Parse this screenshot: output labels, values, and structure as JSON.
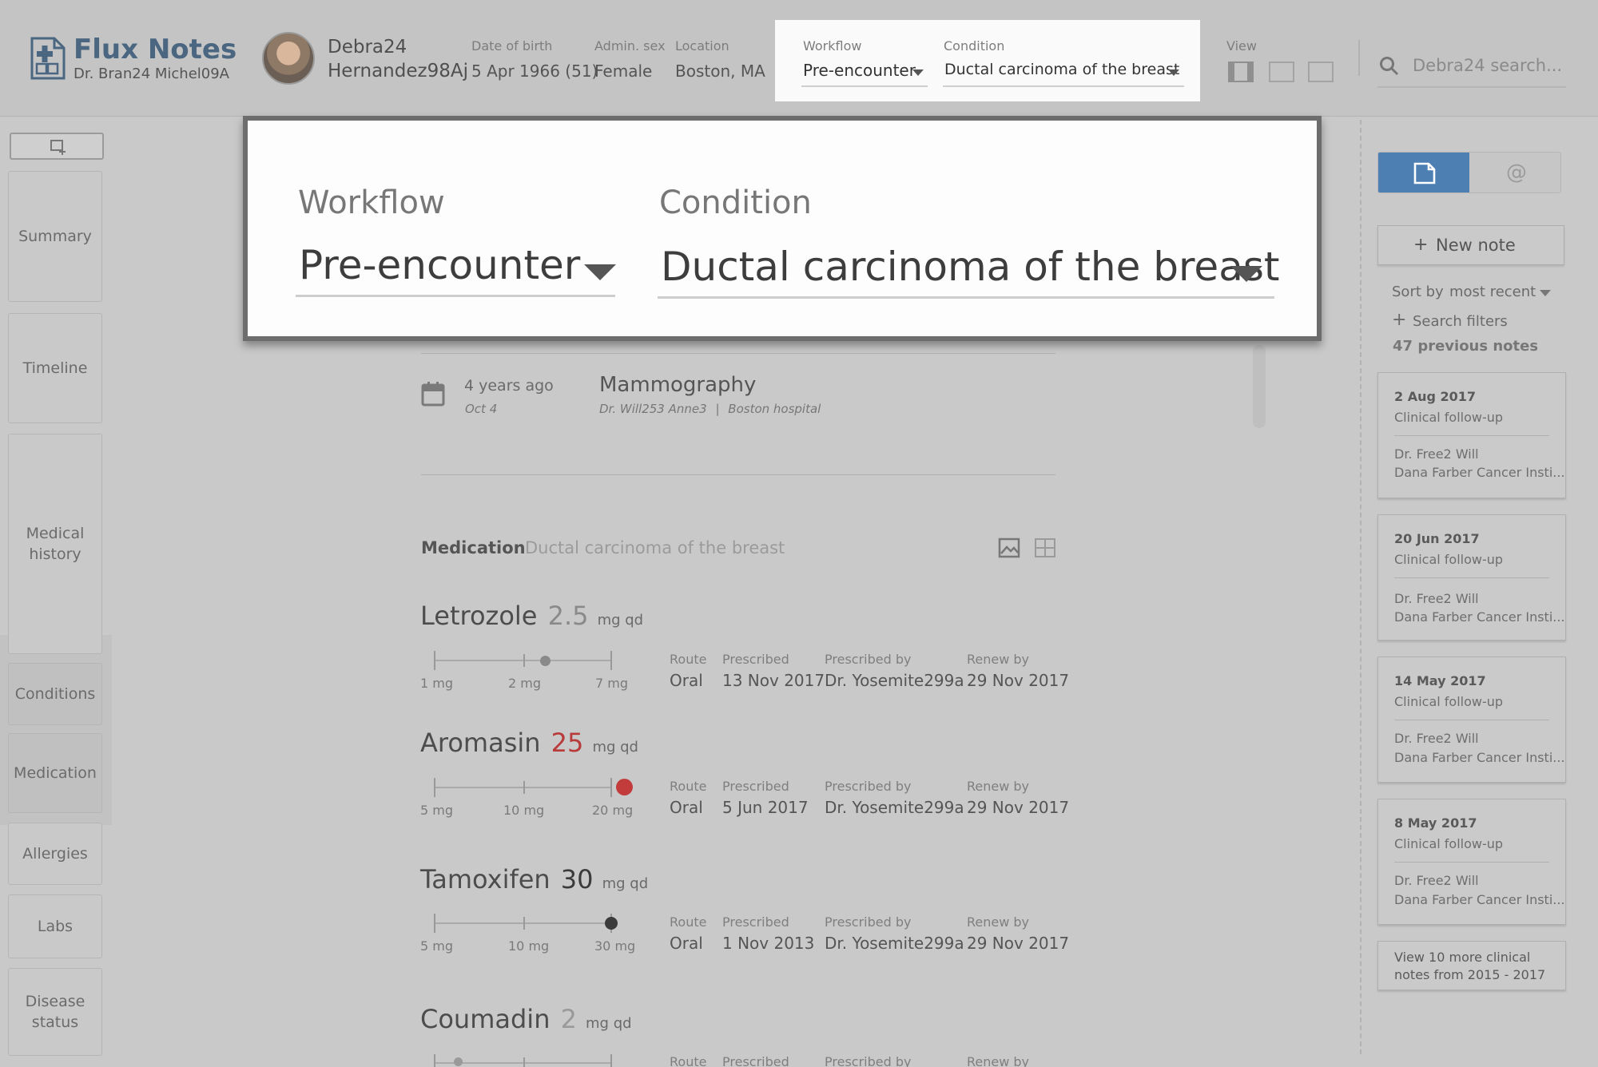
{
  "header": {
    "app_title": "Flux Notes",
    "doctor": "Dr. Bran24 Michel09A",
    "patient_first": "Debra24",
    "patient_last": "Hernandez98Aj",
    "dob_label": "Date of birth",
    "dob_value": "5 Apr 1966 (51)",
    "sex_label": "Admin. sex",
    "sex_value": "Female",
    "location_label": "Location",
    "location_value": "Boston, MA",
    "workflow_label": "Workflow",
    "workflow_value": "Pre-encounter",
    "condition_label": "Condition",
    "condition_value": "Ductal carcinoma of the breast",
    "view_label": "View",
    "search_placeholder": "Debra24 search..."
  },
  "overlay": {
    "workflow_label": "Workflow",
    "workflow_value": "Pre-encounter",
    "condition_label": "Condition",
    "condition_value": "Ductal carcinoma of the breast"
  },
  "sidebar": {
    "items": [
      {
        "label": "Summary"
      },
      {
        "label": "Timeline"
      },
      {
        "label": "Medical history"
      },
      {
        "label": "Conditions"
      },
      {
        "label": "Medication"
      },
      {
        "label": "Allergies"
      },
      {
        "label": "Labs"
      },
      {
        "label": "Disease status"
      }
    ]
  },
  "procedure": {
    "ago": "4 years ago",
    "date": "Oct 4",
    "name": "Mammography",
    "doctor": "Dr. Will253 Anne3",
    "separator": "|",
    "place": "Boston hospital"
  },
  "medication": {
    "section_title": "Medication",
    "section_condition": "Ductal carcinoma of the breast",
    "route_label": "Route",
    "prescribed_label": "Prescribed",
    "prescribed_by_label": "Prescribed by",
    "renew_label": "Renew by",
    "items": [
      {
        "name": "Letrozole",
        "dose": "2.5",
        "unit": "mg qd",
        "ticks": [
          "1 mg",
          "2 mg",
          "7 mg"
        ],
        "route": "Oral",
        "prescribed": "13 Nov 2017",
        "by": "Dr. Yosemite299a",
        "renew": "29 Nov 2017",
        "dose_color": "#8a8a8a",
        "marker_color": "#8a8a8a"
      },
      {
        "name": "Aromasin",
        "dose": "25",
        "unit": "mg qd",
        "ticks": [
          "5 mg",
          "10 mg",
          "20 mg"
        ],
        "route": "Oral",
        "prescribed": "5 Jun 2017",
        "by": "Dr. Yosemite299a",
        "renew": "29 Nov 2017",
        "dose_color": "#b93a3a",
        "marker_color": "#c23c3c"
      },
      {
        "name": "Tamoxifen",
        "dose": "30",
        "unit": "mg qd",
        "ticks": [
          "5 mg",
          "10 mg",
          "30 mg"
        ],
        "route": "Oral",
        "prescribed": "1 Nov 2013",
        "by": "Dr. Yosemite299a",
        "renew": "29 Nov 2017",
        "dose_color": "#3b3b3b",
        "marker_color": "#3b3b3b"
      },
      {
        "name": "Coumadin",
        "dose": "2",
        "unit": "mg qd",
        "ticks": [],
        "route": "",
        "prescribed": "",
        "by": "",
        "renew": "",
        "dose_color": "#9a9a9a",
        "marker_color": "#9a9a9a"
      }
    ],
    "partial_labels": {
      "route": "Route",
      "prescribed": "Prescribed",
      "by": "Prescribed by",
      "renew": "Renew by"
    }
  },
  "notes": {
    "new_note": "New note",
    "sort_by": "Sort by",
    "sort_value": "most recent",
    "search_filters": "Search filters",
    "previous_count": "47 previous notes",
    "items": [
      {
        "date": "2 Aug 2017",
        "type": "Clinical follow-up",
        "doctor": "Dr. Free2 Will",
        "org": "Dana Farber Cancer Insti..."
      },
      {
        "date": "20 Jun 2017",
        "type": "Clinical follow-up",
        "doctor": "Dr. Free2 Will",
        "org": "Dana Farber Cancer Insti..."
      },
      {
        "date": "14 May 2017",
        "type": "Clinical follow-up",
        "doctor": "Dr. Free2 Will",
        "org": "Dana Farber Cancer Insti..."
      },
      {
        "date": "8 May 2017",
        "type": "Clinical follow-up",
        "doctor": "Dr. Free2 Will",
        "org": "Dana Farber Cancer Insti..."
      }
    ],
    "view_more_1": "View 10 more clinical",
    "view_more_2": "notes from 2015 - 2017"
  },
  "colors": {
    "accent": "#4d7fb3",
    "danger": "#c23c3c"
  }
}
